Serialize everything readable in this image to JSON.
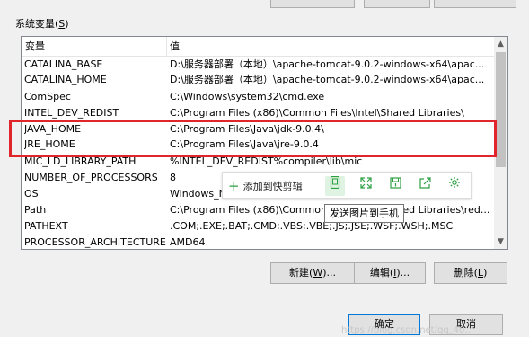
{
  "group": {
    "label": "系统变量(S)",
    "label_prefix": "系统变量(",
    "label_key": "S",
    "label_suffix": ")"
  },
  "table": {
    "columns": [
      "变量",
      "值"
    ],
    "rows": [
      {
        "name": "CATALINA_BASE",
        "value": "D:\\服务器部署（本地）\\apache-tomcat-9.0.2-windows-x64\\apac..."
      },
      {
        "name": "CATALINA_HOME",
        "value": "D:\\服务器部署（本地）\\apache-tomcat-9.0.2-windows-x64\\apac..."
      },
      {
        "name": "ComSpec",
        "value": "C:\\Windows\\system32\\cmd.exe"
      },
      {
        "name": "INTEL_DEV_REDIST",
        "value": "C:\\Program Files (x86)\\Common Files\\Intel\\Shared Libraries\\"
      },
      {
        "name": "JAVA_HOME",
        "value": "C:\\Program Files\\Java\\jdk-9.0.4\\"
      },
      {
        "name": "JRE_HOME",
        "value": "C:\\Program Files\\Java\\jre-9.0.4"
      },
      {
        "name": "MIC_LD_LIBRARY_PATH",
        "value": "%INTEL_DEV_REDIST%compiler\\lib\\mic"
      },
      {
        "name": "NUMBER_OF_PROCESSORS",
        "value": "8"
      },
      {
        "name": "OS",
        "value": "Windows_NT"
      },
      {
        "name": "Path",
        "value": "C:\\Program Files (x86)\\Common Files\\Intel\\Shared Libraries\\red..."
      },
      {
        "name": "PATHEXT",
        "value": ".COM;.EXE;.BAT;.CMD;.VBS;.VBE;.JS;.JSE;.WSF;.WSH;.MSC"
      },
      {
        "name": "PROCESSOR_ARCHITECTURE",
        "value": "AMD64"
      }
    ]
  },
  "overlay": {
    "add_label": "添加到快剪辑",
    "tooltip": "发送图片到手机",
    "icons": [
      "phone-icon",
      "expand-icon",
      "save-icon",
      "share-icon",
      "settings-icon"
    ],
    "accent": "#2ea043",
    "highlight_color": "#e0262b"
  },
  "buttons": {
    "new": {
      "prefix": "新建(",
      "key": "W",
      "suffix": ")..."
    },
    "edit": {
      "prefix": "编辑(",
      "key": "I",
      "suffix": ")..."
    },
    "delete": {
      "prefix": "删除(",
      "key": "L",
      "suffix": ")"
    },
    "ok": "确定",
    "cancel": "取消"
  },
  "watermark": "https://blog.csdn.net/qq_40..."
}
